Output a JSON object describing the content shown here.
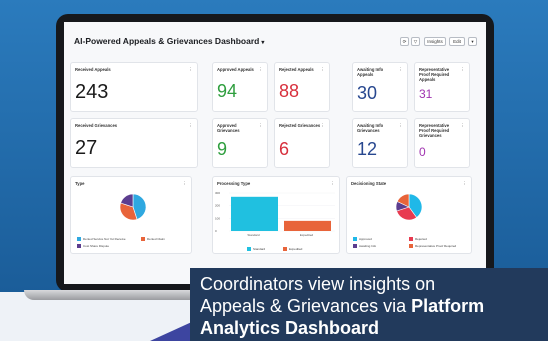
{
  "dashboard": {
    "title": "AI-Powered Appeals & Grievances Dashboard",
    "caret": "▾",
    "toolbar": {
      "insights": "Insights",
      "edit": "Edit",
      "more": "▾"
    }
  },
  "cards": {
    "received_appeals": {
      "title": "Received Appeals",
      "value": "243"
    },
    "approved_appeals": {
      "title": "Approved Appeals",
      "value": "94"
    },
    "rejected_appeals": {
      "title": "Rejected Appeals",
      "value": "88"
    },
    "awaiting_info_appeals": {
      "title": "Awaiting Info Appeals",
      "value": "30"
    },
    "rep_proof_appeals": {
      "title": "Representative Proof Required Appeals",
      "value": "31"
    },
    "received_grievances": {
      "title": "Received Grievances",
      "value": "27"
    },
    "approved_grievances": {
      "title": "Approved Grievances",
      "value": "9"
    },
    "rejected_grievances": {
      "title": "Rejected Grievances",
      "value": "6"
    },
    "awaiting_info_grievances": {
      "title": "Awaiting Info Grievances",
      "value": "12"
    },
    "rep_proof_grievances": {
      "title": "Representative Proof Required Grievances",
      "value": "0"
    }
  },
  "menu_icon": "⋮",
  "chart_data": [
    {
      "type": "pie",
      "title": "Type",
      "labels": [
        "Denied Service Not Yet Receive",
        "Denied Claim",
        "Cost Share Dispute"
      ],
      "values": [
        45,
        35,
        20
      ],
      "colors": [
        "#2fa8e0",
        "#e8643a",
        "#5c3d8f"
      ]
    },
    {
      "type": "bar",
      "title": "Processing Type",
      "categories": [
        "Standard",
        "Expedited"
      ],
      "values": [
        270,
        80
      ],
      "colors": [
        "#20c0e0",
        "#e8643a"
      ],
      "yticks": [
        "300",
        "200",
        "100",
        "0"
      ],
      "ylim": [
        0,
        300
      ]
    },
    {
      "type": "pie",
      "title": "Decisioning State",
      "labels": [
        "Approved",
        "Rejected",
        "Awaiting Info",
        "Representative Proof Required"
      ],
      "values": [
        40,
        30,
        12,
        18
      ],
      "colors": [
        "#20b8e8",
        "#e83a50",
        "#5c3d8f",
        "#e8643a"
      ]
    }
  ],
  "caption": {
    "line1": "Coordinators view insights on",
    "line2_plain": "Appeals & Grievances via ",
    "line2_bold": "Platform",
    "line3_bold": "Analytics Dashboard"
  }
}
